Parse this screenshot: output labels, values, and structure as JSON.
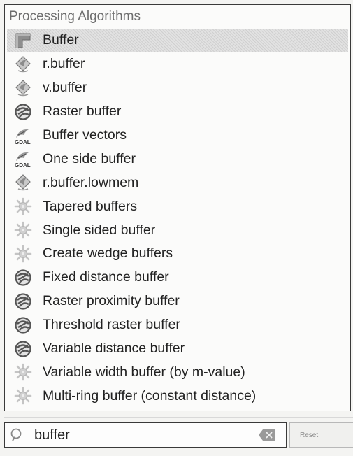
{
  "header": {
    "title": "Processing Algorithms"
  },
  "items": [
    {
      "label": "Buffer",
      "icon": "qgis-buffer-icon",
      "selected": true
    },
    {
      "label": "r.buffer",
      "icon": "grass-icon"
    },
    {
      "label": "v.buffer",
      "icon": "grass-icon"
    },
    {
      "label": "Raster buffer",
      "icon": "saga-icon"
    },
    {
      "label": "Buffer vectors",
      "icon": "gdal-icon"
    },
    {
      "label": "One side buffer",
      "icon": "gdal-icon"
    },
    {
      "label": "r.buffer.lowmem",
      "icon": "grass-icon"
    },
    {
      "label": "Tapered buffers",
      "icon": "gear-icon"
    },
    {
      "label": "Single sided buffer",
      "icon": "gear-icon"
    },
    {
      "label": "Create wedge buffers",
      "icon": "gear-icon"
    },
    {
      "label": "Fixed distance buffer",
      "icon": "saga-icon"
    },
    {
      "label": "Raster proximity buffer",
      "icon": "saga-icon"
    },
    {
      "label": "Threshold raster buffer",
      "icon": "saga-icon"
    },
    {
      "label": "Variable distance buffer",
      "icon": "saga-icon"
    },
    {
      "label": "Variable width buffer (by m-value)",
      "icon": "gear-icon"
    },
    {
      "label": "Multi-ring buffer (constant distance)",
      "icon": "gear-icon"
    }
  ],
  "search": {
    "value": "buffer",
    "icon": "search-icon",
    "clear_icon": "clear-icon"
  },
  "reset": {
    "label": "Reset"
  },
  "gdal_text": "GDAL"
}
